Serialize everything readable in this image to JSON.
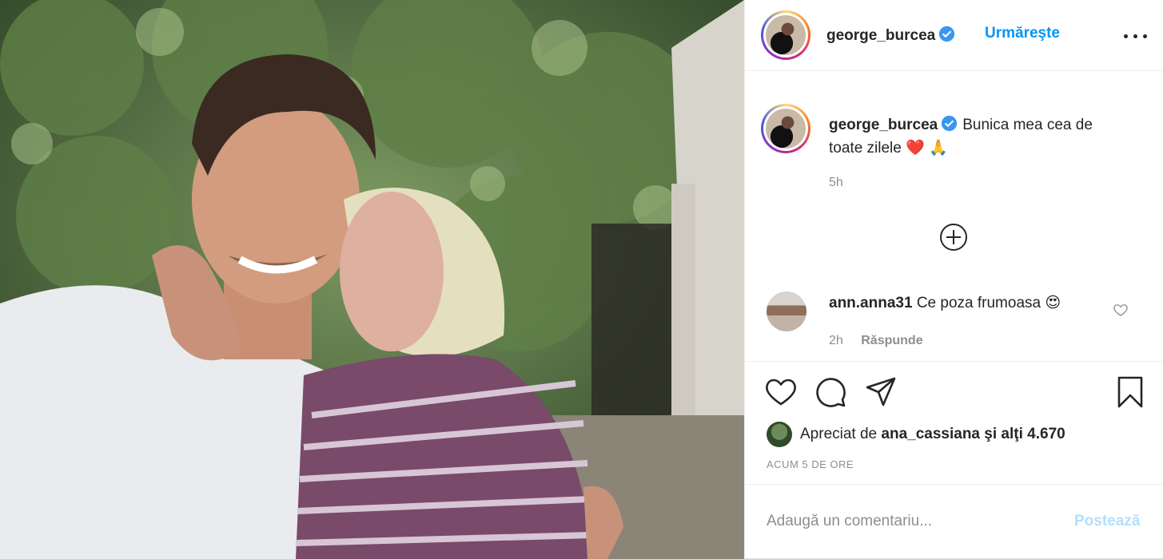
{
  "post": {
    "username": "george_burcea",
    "verified": true,
    "follow_label": "Urmăreşte",
    "more_icon": "more-options-icon"
  },
  "caption": {
    "username": "george_burcea",
    "text": "Bunica mea cea de toate zilele",
    "emojis": "❤️ 🙏",
    "time": "5h"
  },
  "load_more_icon": "plus-circle-icon",
  "comment": {
    "username": "ann.anna31",
    "text": "Ce poza frumoasa",
    "emoji": "😍",
    "time": "2h",
    "reply_label": "Răspunde"
  },
  "actions": {
    "icons": [
      "heart-icon",
      "comment-icon",
      "share-icon",
      "bookmark-icon"
    ]
  },
  "likes": {
    "prefix": "Apreciat de",
    "user": "ana_cassiana",
    "joiner": "şi",
    "others": "alţi 4.670"
  },
  "timestamp": "ACUM 5 DE ORE",
  "add_comment": {
    "placeholder": "Adaugă un comentariu...",
    "post_label": "Postează"
  },
  "colors": {
    "accent": "#0095f6",
    "verified": "#3897f0",
    "post_disabled": "#b2dffc",
    "muted": "#8e8e8e"
  }
}
